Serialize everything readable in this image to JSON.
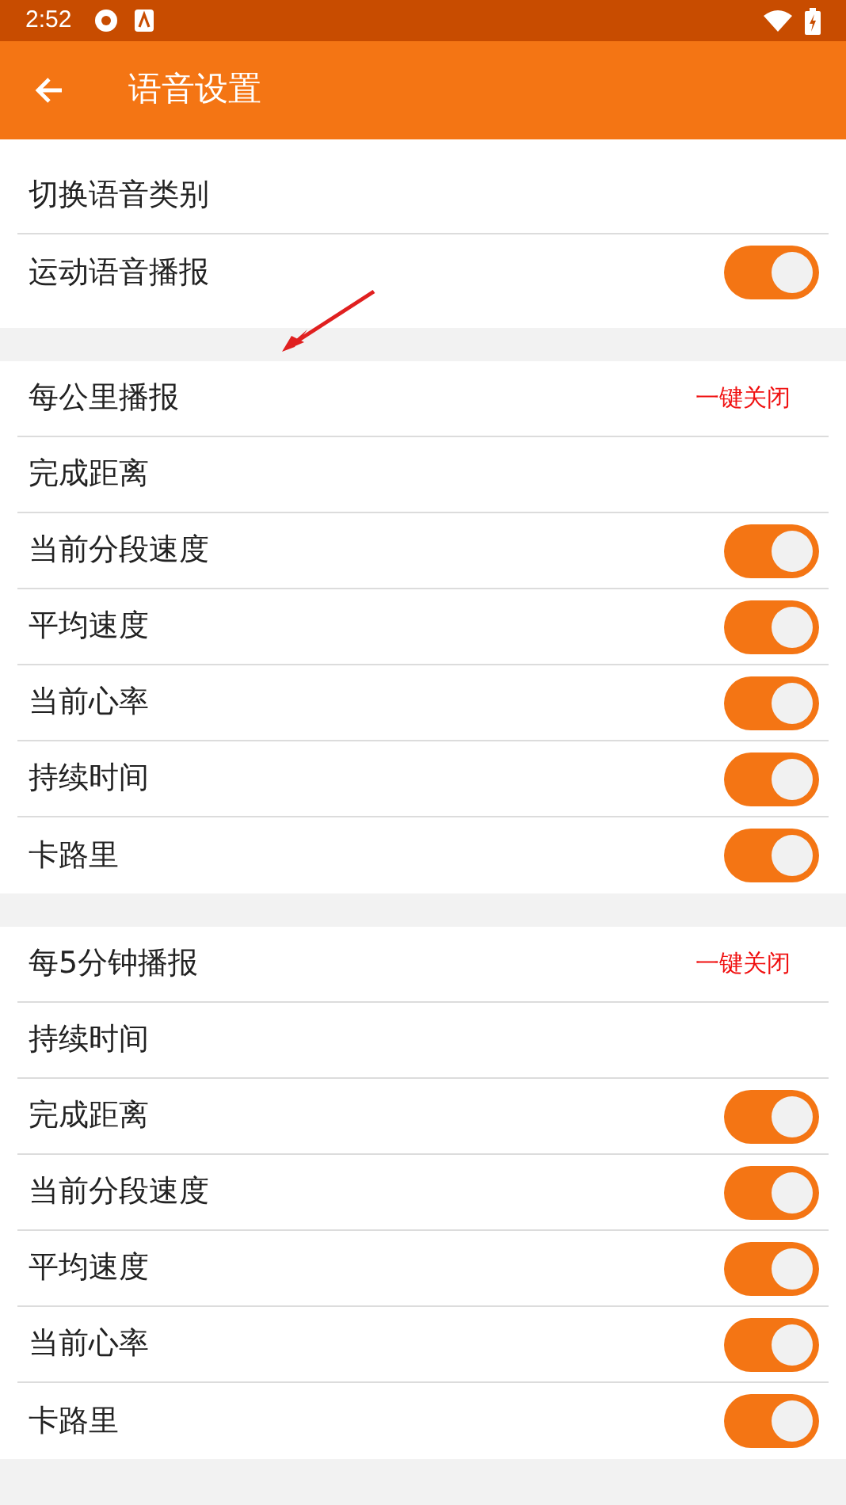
{
  "status_bar": {
    "time": "2:52"
  },
  "app_bar": {
    "title": "语音设置"
  },
  "sections": [
    {
      "rows": [
        {
          "kind": "plain",
          "label": "切换语音类别"
        },
        {
          "kind": "toggle",
          "label": "运动语音播报",
          "on": true
        }
      ]
    },
    {
      "rows": [
        {
          "kind": "header",
          "label": "每公里播报",
          "action": "一键关闭"
        },
        {
          "kind": "plain",
          "label": "完成距离"
        },
        {
          "kind": "toggle",
          "label": "当前分段速度",
          "on": true
        },
        {
          "kind": "toggle",
          "label": "平均速度",
          "on": true
        },
        {
          "kind": "toggle",
          "label": "当前心率",
          "on": true
        },
        {
          "kind": "toggle",
          "label": "持续时间",
          "on": true
        },
        {
          "kind": "toggle",
          "label": "卡路里",
          "on": true
        }
      ]
    },
    {
      "rows": [
        {
          "kind": "header",
          "label": "每5分钟播报",
          "action": "一键关闭"
        },
        {
          "kind": "plain",
          "label": "持续时间"
        },
        {
          "kind": "toggle",
          "label": "完成距离",
          "on": true
        },
        {
          "kind": "toggle",
          "label": "当前分段速度",
          "on": true
        },
        {
          "kind": "toggle",
          "label": "平均速度",
          "on": true
        },
        {
          "kind": "toggle",
          "label": "当前心率",
          "on": true
        },
        {
          "kind": "toggle",
          "label": "卡路里",
          "on": true
        }
      ]
    }
  ]
}
